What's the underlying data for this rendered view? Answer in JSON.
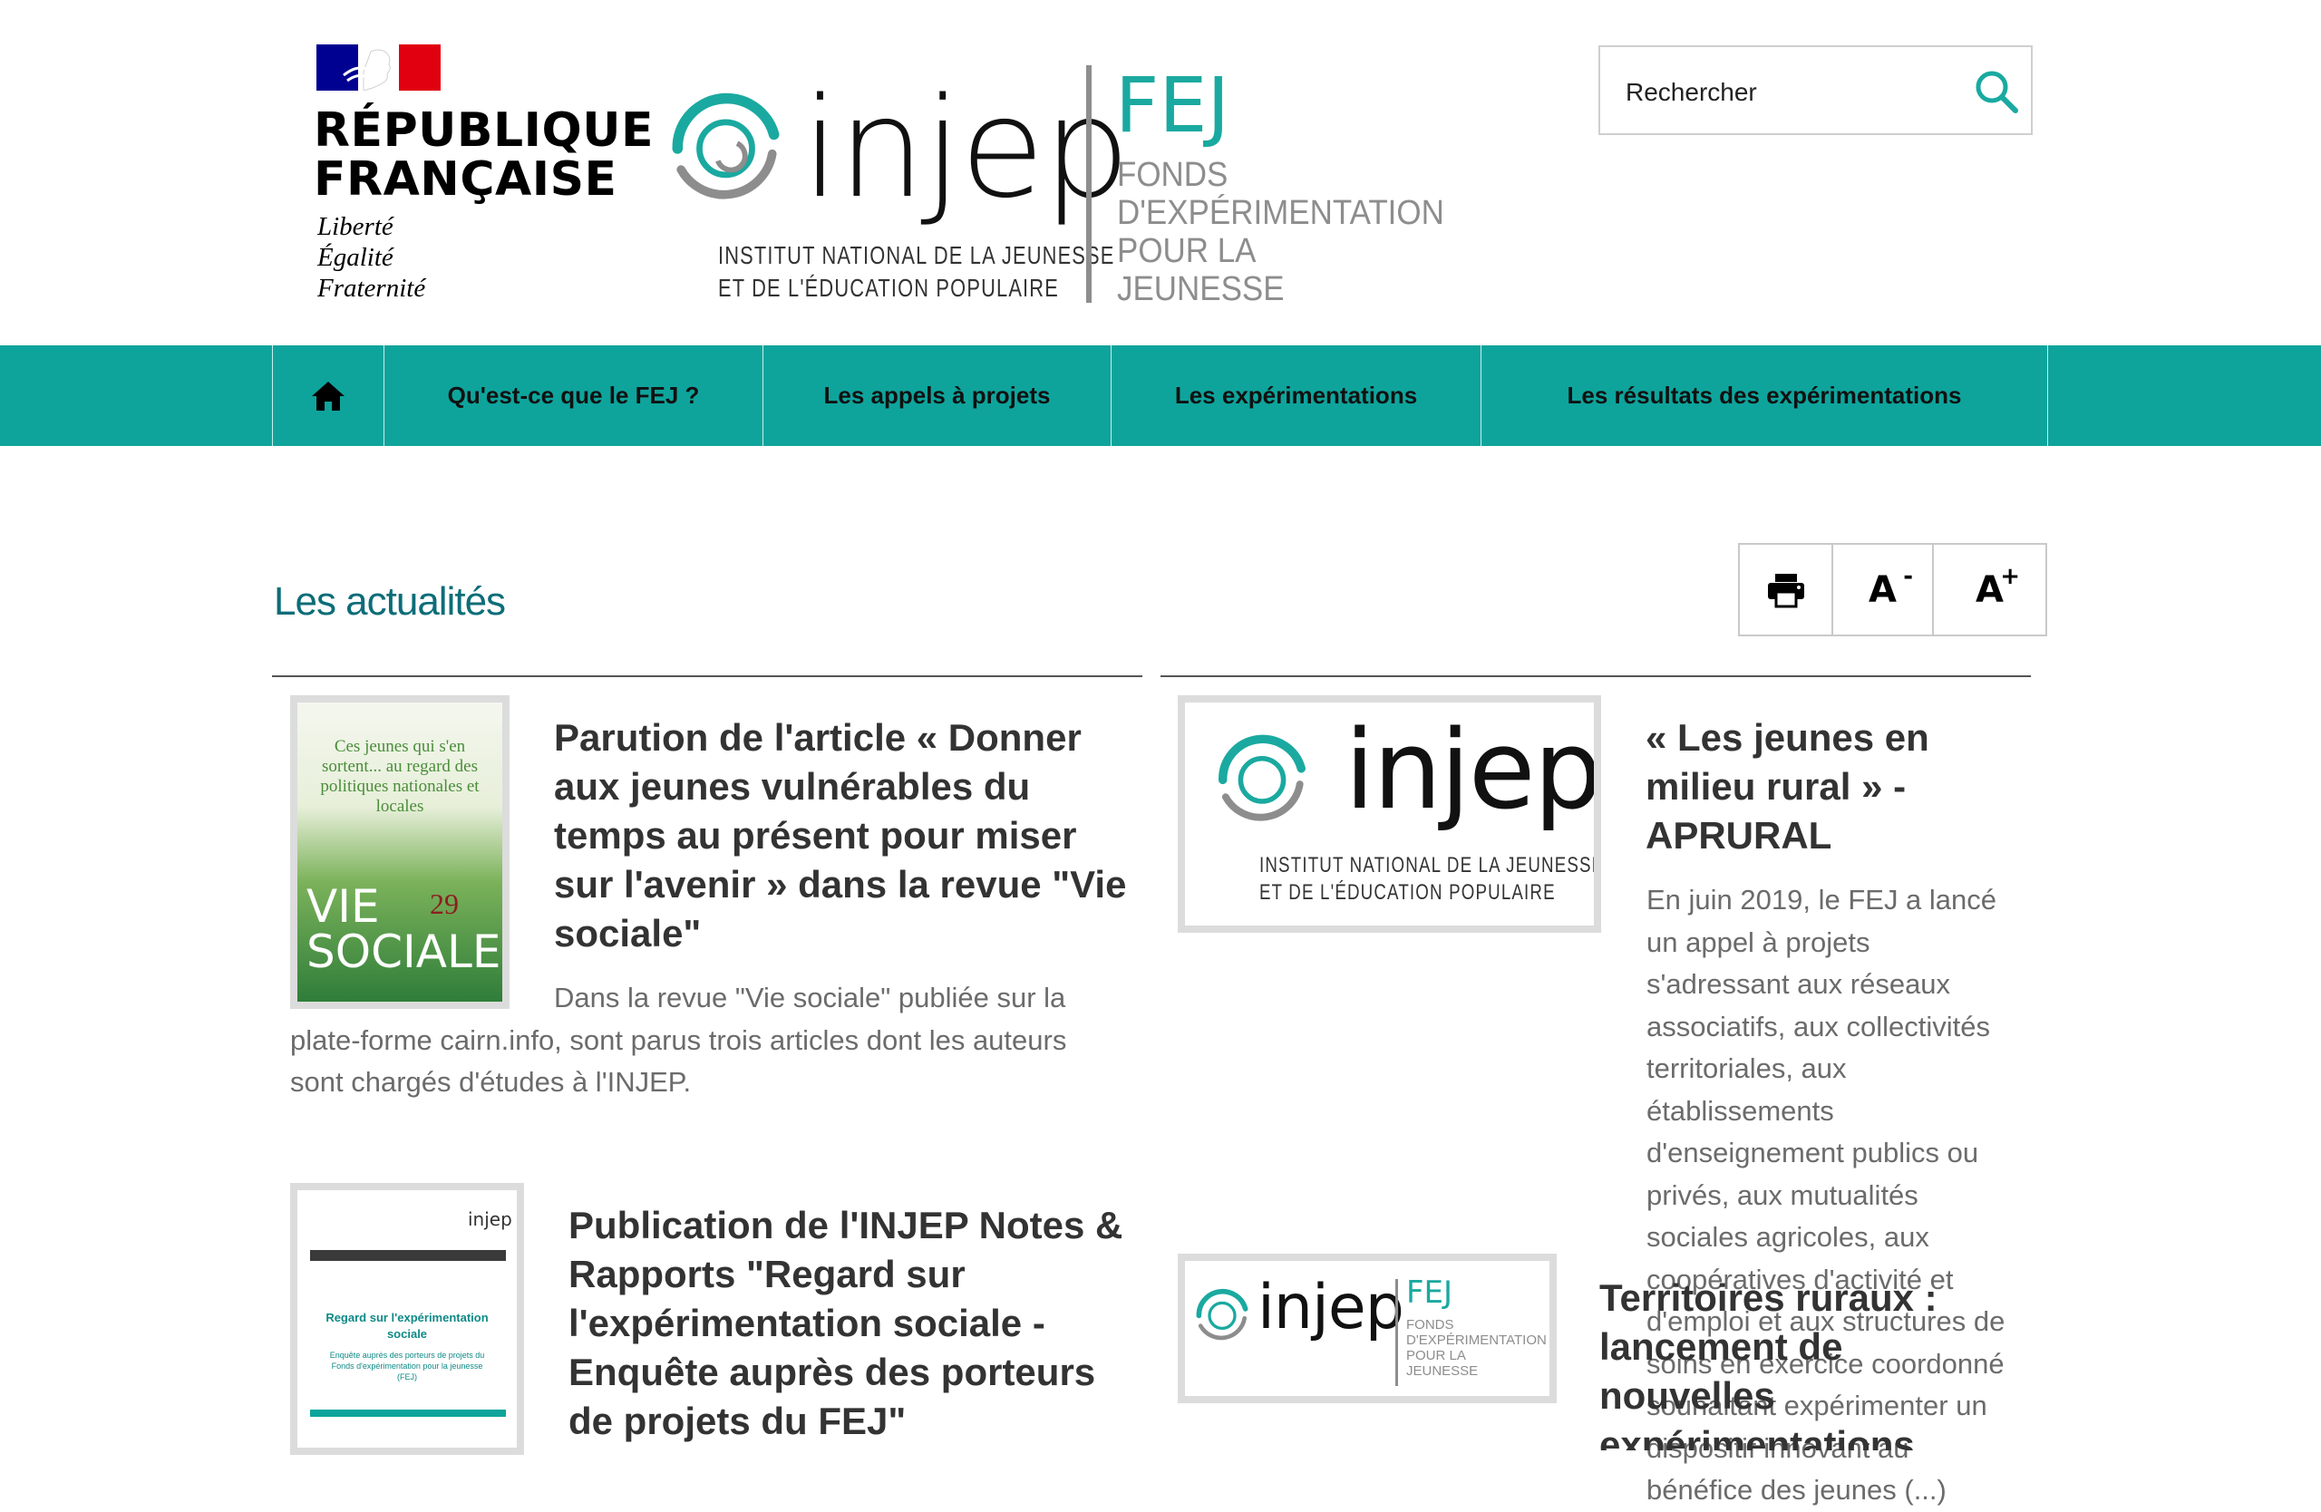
{
  "header": {
    "republic": {
      "line1": "RÉPUBLIQUE",
      "line2": "FRANÇAISE",
      "motto": [
        "Liberté",
        "Égalité",
        "Fraternité"
      ]
    },
    "injep_logo": {
      "wordmark": "injep",
      "subtitle_line1": "INSTITUT NATIONAL DE LA JEUNESSE",
      "subtitle_line2": "ET DE L'ÉDUCATION POPULAIRE"
    },
    "fej_logo": {
      "title": "FEJ",
      "lines": [
        "FONDS",
        "D'EXPÉRIMENTATION",
        "POUR LA",
        "JEUNESSE"
      ]
    },
    "search": {
      "placeholder": "Rechercher",
      "icon": "search-icon"
    }
  },
  "nav": {
    "home_icon": "home-icon",
    "items": [
      "Qu'est-ce que le FEJ ?",
      "Les appels à projets",
      "Les expérimentations",
      "Les résultats des expérimentations"
    ]
  },
  "page": {
    "title": "Les actualités"
  },
  "tools": {
    "print_icon": "printer-icon",
    "decrease_label": "A",
    "decrease_symbol": "-",
    "increase_label": "A",
    "increase_symbol": "+"
  },
  "articles": [
    {
      "title": "Parution de l'article « Donner aux jeunes vulnérables du temps au présent pour miser sur l'avenir » dans la revue \"Vie sociale\"",
      "text": "Dans la revue \"Vie sociale\" publiée sur la plate-forme cairn.info, sont parus trois articles dont les auteurs sont chargés d'études à l'INJEP.",
      "thumb": {
        "kicker": "Ces jeunes qui s'en sortent... au regard des politiques nationales et locales",
        "issue": "29",
        "word1": "VIE",
        "word2": "SOCIALE"
      }
    },
    {
      "title": "Publication de l'INJEP Notes & Rapports \"Regard sur l'expérimentation sociale - Enquête auprès des porteurs de projets du FEJ\"",
      "thumb": {
        "brand": "injep",
        "heading": "Regard sur l'expérimentation sociale",
        "sub": "Enquête auprès des porteurs de projets du Fonds d'expérimentation pour la jeunesse (FEJ)"
      }
    },
    {
      "title": "« Les jeunes en milieu rural » - APRURAL",
      "text": "En juin 2019, le FEJ a lancé un appel à projets s'adressant aux réseaux associatifs, aux collectivités territoriales, aux établissements d'enseignement publics ou privés, aux mutualités sociales agricoles, aux coopératives d'activité et d'emploi et aux structures de soins en exercice coordonné souhaitant expérimenter un dispositif innovant au bénéfice des jeunes (...)"
    },
    {
      "title": "Territoires ruraux : lancement de nouvelles expérimentations"
    }
  ],
  "colors": {
    "nav_bg": "#0ea49c",
    "title_color": "#0c6d78",
    "fej_teal": "#1aa9a0"
  }
}
